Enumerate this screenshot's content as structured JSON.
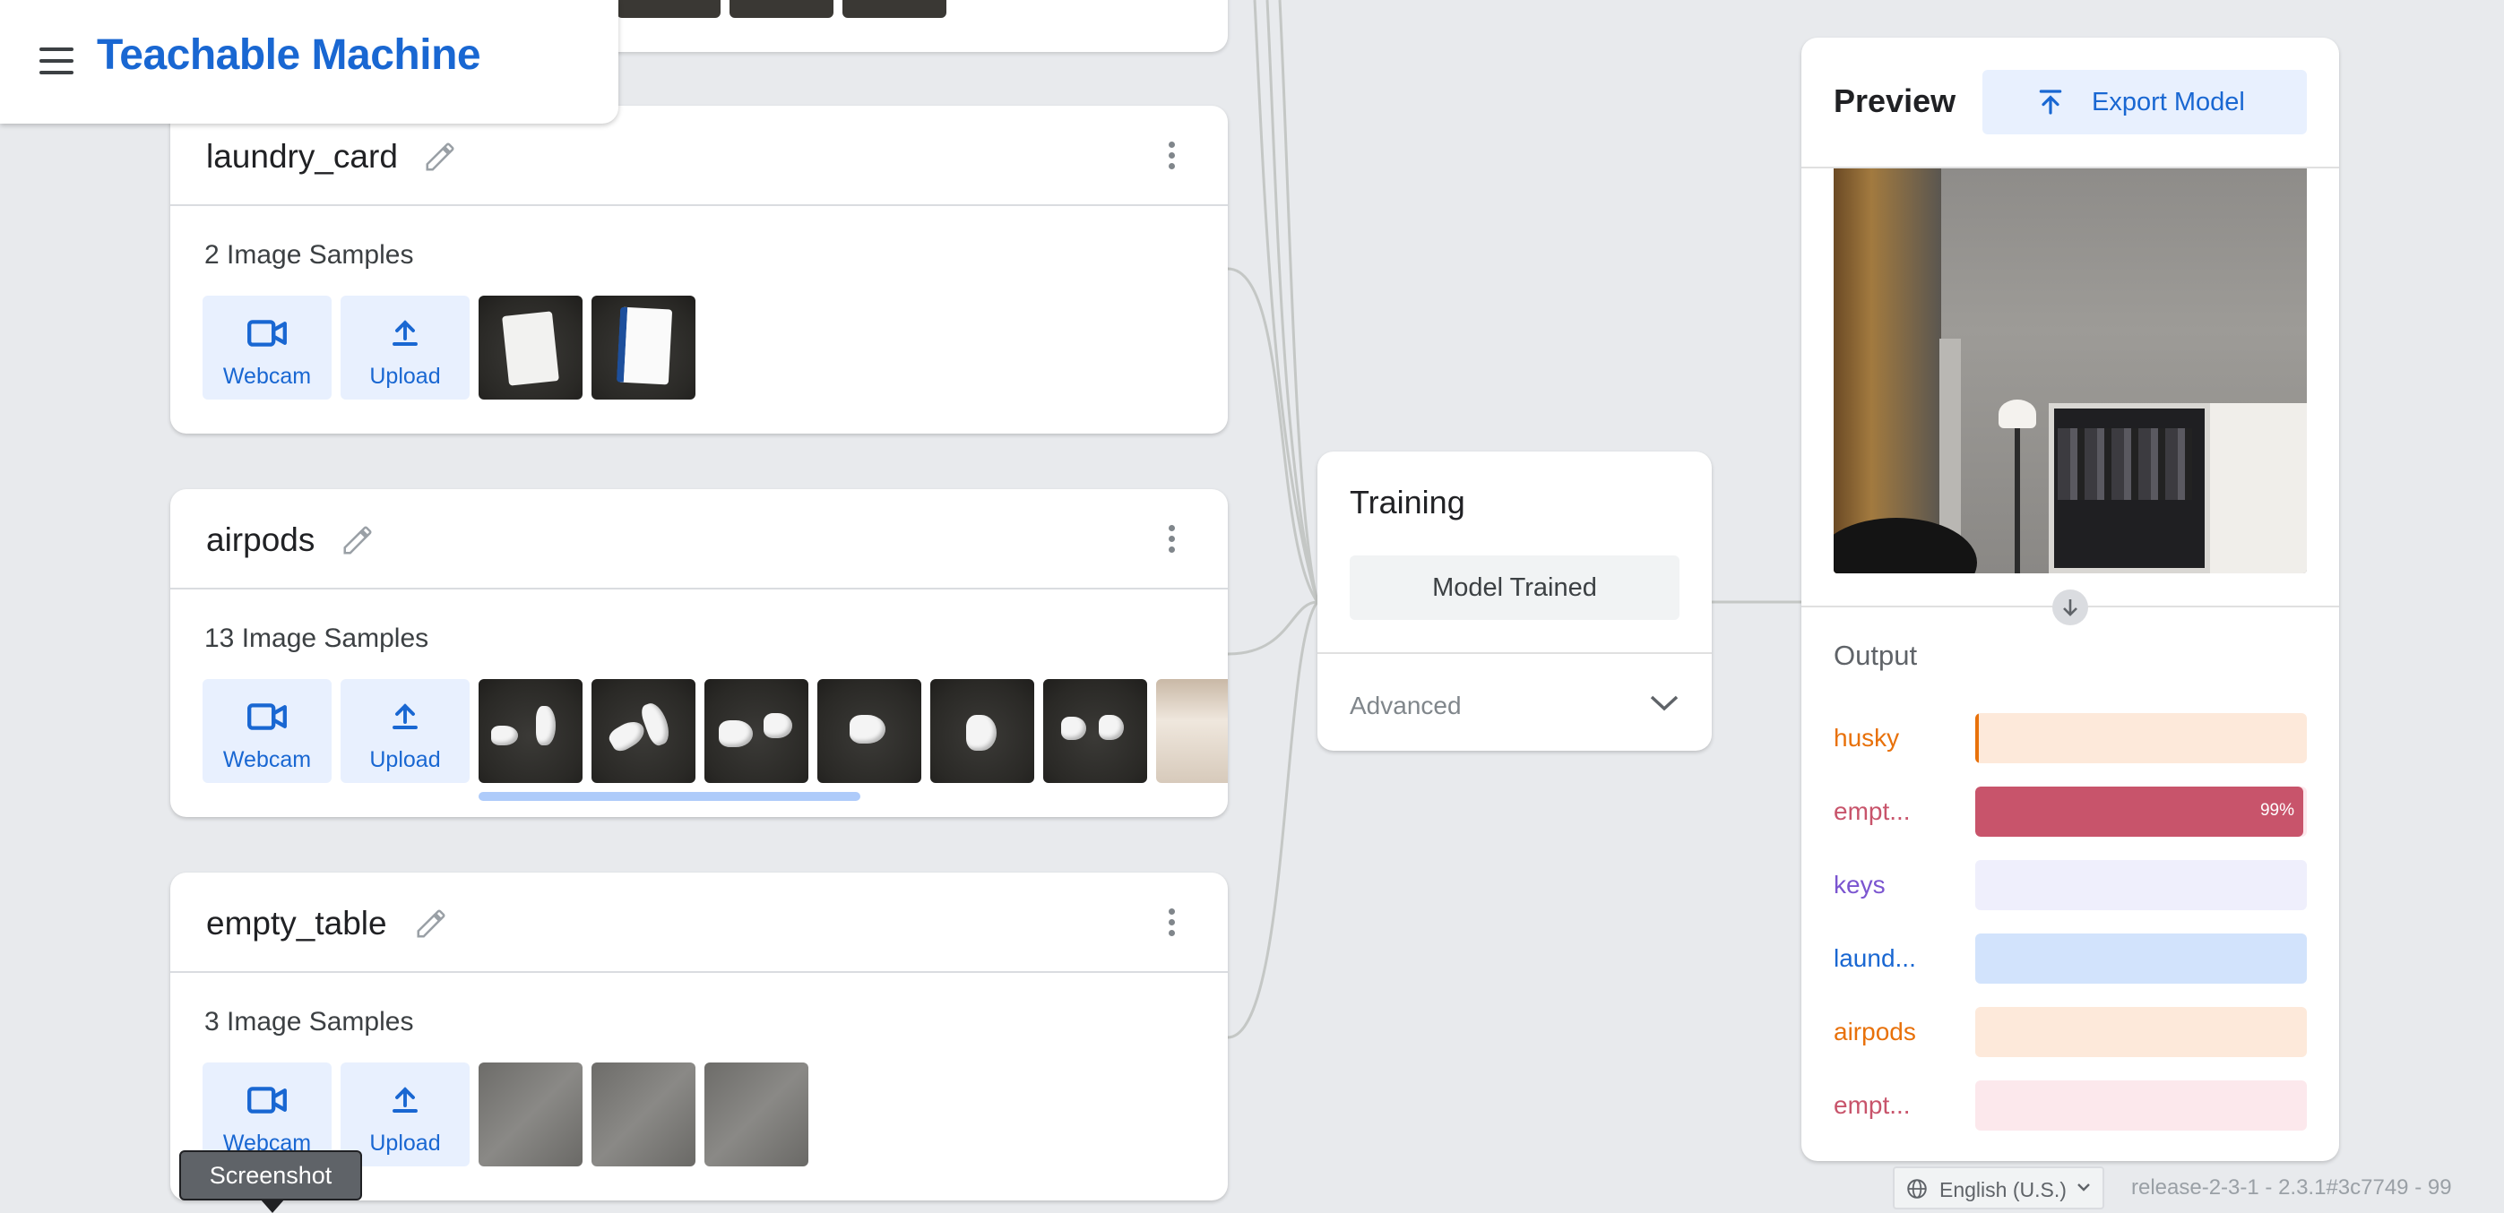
{
  "header": {
    "title": "Teachable Machine"
  },
  "classes": [
    {
      "name": "laundry_card",
      "samples_text": "2 Image Samples",
      "webcam_label": "Webcam",
      "upload_label": "Upload"
    },
    {
      "name": "airpods",
      "samples_text": "13 Image Samples",
      "webcam_label": "Webcam",
      "upload_label": "Upload"
    },
    {
      "name": "empty_table",
      "samples_text": "3 Image Samples",
      "webcam_label": "Webcam",
      "upload_label": "Upload"
    }
  ],
  "training": {
    "title": "Training",
    "status_button": "Model Trained",
    "advanced_label": "Advanced"
  },
  "preview": {
    "title": "Preview",
    "export_label": "Export Model",
    "output_title": "Output",
    "outputs": [
      {
        "label": "husky",
        "percent": 1,
        "color": "#e8710a",
        "track": "#fde9da"
      },
      {
        "label": "empt...",
        "percent": 99,
        "percent_text": "99%",
        "color": "#c8546b",
        "track": "#fce8ec"
      },
      {
        "label": "keys",
        "percent": 0,
        "color": "#7b55d0",
        "track": "#efeffc"
      },
      {
        "label": "laund...",
        "percent": 0,
        "color": "#1967d2",
        "track": "#d2e3fc"
      },
      {
        "label": "airpods",
        "percent": 0,
        "color": "#e8710a",
        "track": "#fde9da"
      },
      {
        "label": "empt...",
        "percent": 0,
        "color": "#c8546b",
        "track": "#fce8ec"
      }
    ]
  },
  "footer": {
    "language": "English (U.S.)",
    "release": "release-2-3-1 - 2.3.1#3c7749 - 99"
  },
  "tooltip": {
    "text": "Screenshot"
  }
}
